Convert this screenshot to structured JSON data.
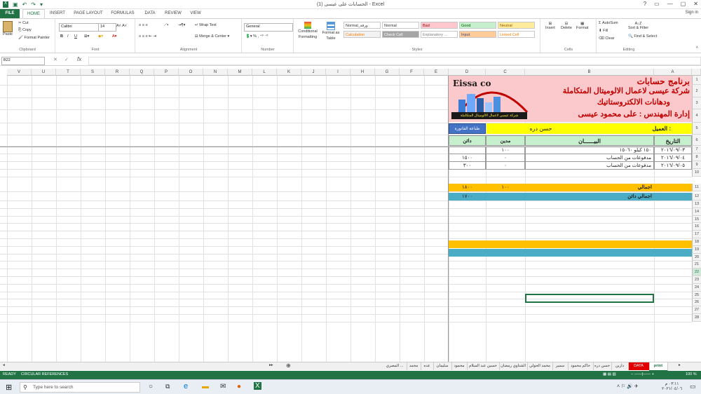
{
  "window": {
    "title": "الحسابات على عيسى (1) - Excel",
    "controls": [
      "?",
      "▭",
      "—",
      "▢",
      "✕"
    ]
  },
  "tabs": [
    "FILE",
    "HOME",
    "INSERT",
    "PAGE LAYOUT",
    "FORMULAS",
    "DATA",
    "REVIEW",
    "VIEW"
  ],
  "signin": "Sign in",
  "ribbon": {
    "clipboard": {
      "paste": "Paste",
      "cut": "Cut",
      "copy": "Copy",
      "format_painter": "Format Painter",
      "label": "Clipboard"
    },
    "font": {
      "name": "Calibri",
      "size": "14",
      "label": "Font"
    },
    "alignment": {
      "wrap": "Wrap Text",
      "merge": "Merge & Center",
      "label": "Alignment"
    },
    "number": {
      "format": "General",
      "label": "Number"
    },
    "styles": {
      "conditional": "Conditional Formatting",
      "format_table": "Format as Table",
      "label": "Styles",
      "cells": [
        {
          "name": "Normal_ورقة",
          "bg": "#ffffff",
          "fg": "#333333"
        },
        {
          "name": "Normal",
          "bg": "#ffffff",
          "fg": "#333333"
        },
        {
          "name": "Bad",
          "bg": "#ffc7ce",
          "fg": "#9c0006"
        },
        {
          "name": "Good",
          "bg": "#c6efce",
          "fg": "#006100"
        },
        {
          "name": "Neutral",
          "bg": "#ffeb9c",
          "fg": "#9c5700"
        },
        {
          "name": "Calculation",
          "bg": "#f2f2f2",
          "fg": "#fa7d00"
        },
        {
          "name": "Check Cell",
          "bg": "#a5a5a5",
          "fg": "#ffffff"
        },
        {
          "name": "Explanatory ...",
          "bg": "#ffffff",
          "fg": "#7f7f7f"
        },
        {
          "name": "Input",
          "bg": "#ffcc99",
          "fg": "#3f3f76"
        },
        {
          "name": "Linked Cell",
          "bg": "#ffffff",
          "fg": "#fa7d00"
        }
      ]
    },
    "cells_group": {
      "insert": "Insert",
      "delete": "Delete",
      "format": "Format",
      "label": "Cells"
    },
    "editing": {
      "autosum": "AutoSum",
      "fill": "Fill",
      "clear": "Clear",
      "sort": "Sort & Filter",
      "find": "Find & Select",
      "label": "Editing"
    }
  },
  "formula_bar": {
    "name_box": "B22",
    "fx": "fx",
    "value": ""
  },
  "columns": [
    "A",
    "B",
    "C",
    "D",
    "E",
    "F",
    "G",
    "H",
    "I",
    "J",
    "K",
    "L",
    "M",
    "N",
    "O",
    "P",
    "Q",
    "R",
    "S",
    "T",
    "U",
    "V"
  ],
  "rows": [
    "1",
    "2",
    "3",
    "4",
    "5",
    "6",
    "7",
    "8",
    "9",
    "10",
    "11",
    "12",
    "13",
    "14",
    "15",
    "16",
    "17",
    "18",
    "19",
    "20",
    "21",
    "22",
    "23",
    "24",
    "25",
    "26",
    "27",
    "28"
  ],
  "sheet": {
    "header_title": "برنامج حسابات",
    "company": "شركة عيسى لاعمال الالوميتال المتكاملة",
    "company2": "ودهانات الالكتروستاتيك",
    "manager": "إدارة المهندس : على محمود عيسى",
    "logo_text": "Eissa co",
    "logo_sub": "شركة عيسى لاعمال الالوميتال المتكاملة",
    "client_label": "العميل :",
    "client_name": "حسن دره",
    "print_invoice": "طباعة الفاتورة",
    "col_date": "التاريخ",
    "col_desc": "البيــــــان",
    "col_debit": "مدين",
    "col_credit": "دائن",
    "entries": [
      {
        "date": "٢٠١٦/٠٩/٠٣",
        "desc": "١٥٠ كيلو ١٥٠٦٠",
        "debit": "١٠٠",
        "credit": ""
      },
      {
        "date": "٢٠١٦/٠٩/٠٤",
        "desc": "مدفوعات من الحساب",
        "debit": "٠",
        "credit": "١٥٠٠"
      },
      {
        "date": "٢٠١٦/٠٩/٠٥",
        "desc": "مدفوعات من الحساب",
        "debit": "٠",
        "credit": "٣٠٠"
      }
    ],
    "total_label": "اجمالي",
    "total_debit": "١٠٠",
    "total_credit": "١٨٠٠",
    "total_credit_label": "اجمالي دائن",
    "total_credit2": "١٧٠٠"
  },
  "sheet_tabs": [
    "print",
    "DATA",
    "داربن",
    "حسن دره",
    "حاكم محمود",
    "سمير",
    "محمد الحولي",
    "الشناوي رمضان",
    "حسين عبد السلام",
    "محمود",
    "سليمان",
    "عده",
    "محمد",
    "المصري ..."
  ],
  "status": {
    "ready": "READY",
    "circular": "CIRCULAR REFERENCES",
    "zoom": "100 %"
  },
  "taskbar": {
    "search": "Type here to search",
    "time": "٠٣:١١ م",
    "date": "٢٠٢١/٠٤/٠٦"
  }
}
